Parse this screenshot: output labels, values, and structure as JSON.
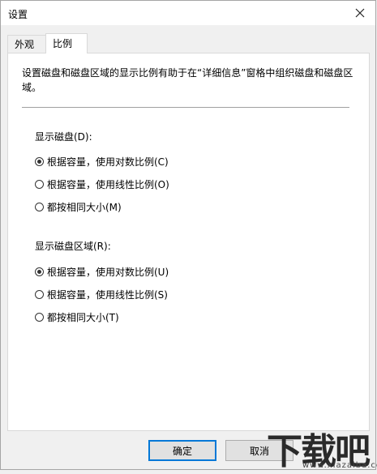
{
  "window": {
    "title": "设置"
  },
  "tabs": [
    {
      "label": "外观"
    },
    {
      "label": "比例"
    }
  ],
  "panel": {
    "description": "设置磁盘和磁盘区域的显示比例有助于在“详细信息”窗格中组织磁盘和磁盘区域。",
    "disk_group": {
      "label": "显示磁盘(D):",
      "options": [
        {
          "label": "根据容量，使用对数比例(C)",
          "checked": true
        },
        {
          "label": "根据容量，使用线性比例(O)",
          "checked": false
        },
        {
          "label": "都按相同大小(M)",
          "checked": false
        }
      ]
    },
    "region_group": {
      "label": "显示磁盘区域(R):",
      "options": [
        {
          "label": "根据容量，使用对数比例(U)",
          "checked": true
        },
        {
          "label": "根据容量，使用线性比例(S)",
          "checked": false
        },
        {
          "label": "都按相同大小(T)",
          "checked": false
        }
      ]
    }
  },
  "buttons": {
    "ok": "确定",
    "cancel": "取消"
  },
  "watermark": {
    "logo": "下载吧",
    "url": "www.xiazaiba.com"
  }
}
